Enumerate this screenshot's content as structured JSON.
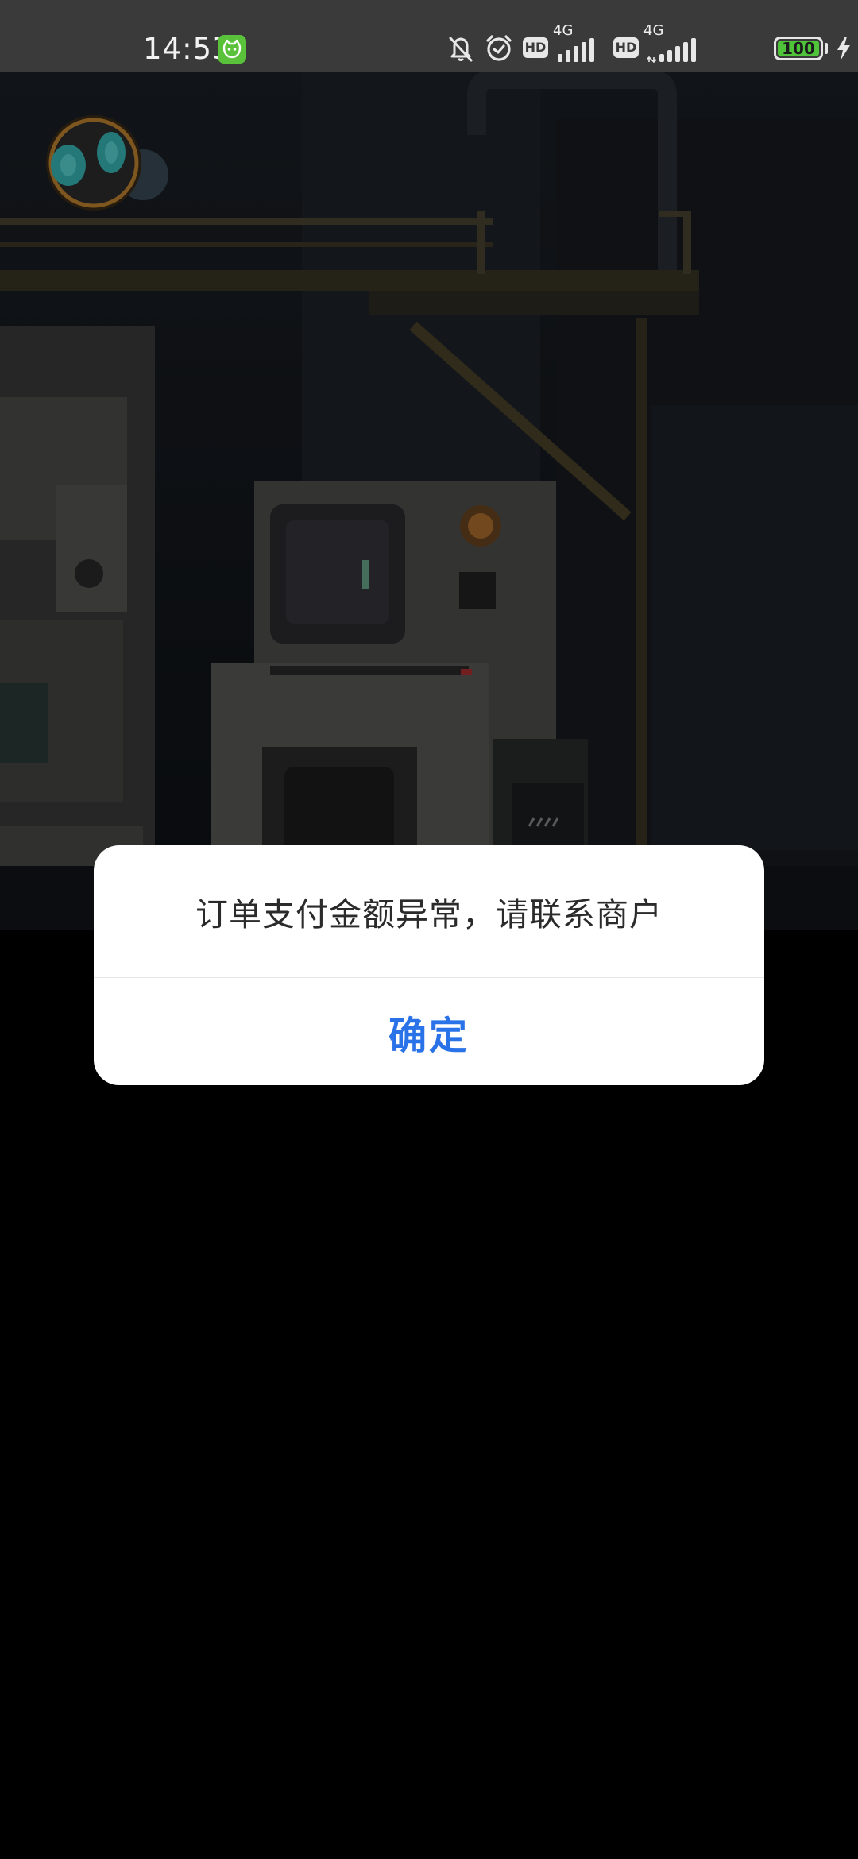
{
  "status_bar": {
    "time": "14:53",
    "app_badge_icon": "cat-face-icon",
    "icons": [
      "bell-muted-icon",
      "alarm-clock-icon",
      "hd-icon",
      "signal-4g-icon",
      "hd-icon",
      "signal-4g-icon",
      "battery-icon",
      "charging-bolt-icon"
    ],
    "hd_label": "HD",
    "network_label_1": "4G",
    "network_label_2": "4G",
    "battery_level": "100",
    "battery_fraction": 1.0,
    "colors": {
      "bar_bg": "#3a3a3a",
      "badge_green": "#59c13a",
      "battery_green": "#4fc33a"
    }
  },
  "background": {
    "description_icon": "game-factory-scene",
    "overlay": "dimmed"
  },
  "dialog": {
    "message": "订单支付金额异常，请联系商户",
    "confirm_label": "确定",
    "colors": {
      "confirm_text": "#2a72e8",
      "message_text": "#2b2b2b"
    }
  }
}
